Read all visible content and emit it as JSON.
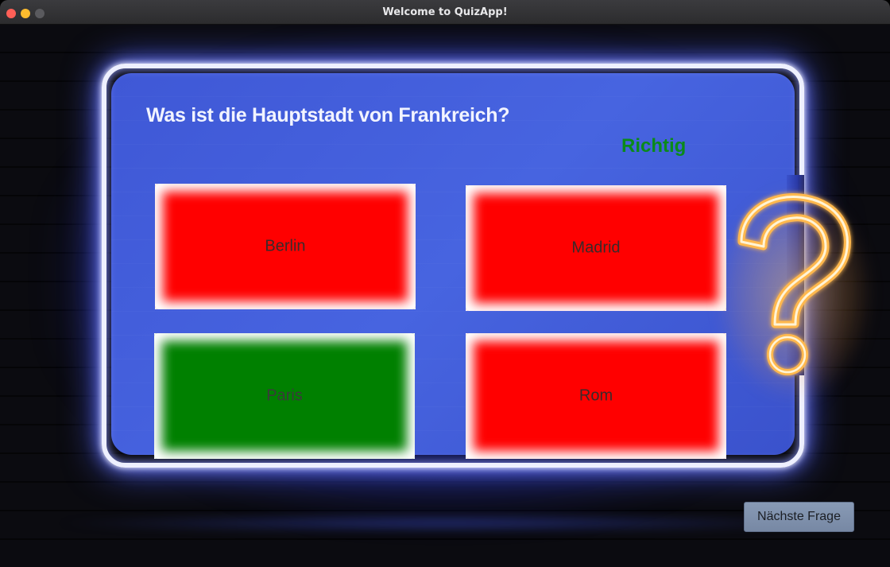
{
  "window": {
    "title": "Welcome to QuizApp!"
  },
  "quiz": {
    "question": "Was ist die Hauptstadt von Frankreich?",
    "feedback": "Richtig",
    "answers": [
      {
        "label": "Berlin",
        "state": "wrong"
      },
      {
        "label": "Madrid",
        "state": "wrong"
      },
      {
        "label": "Paris",
        "state": "correct"
      },
      {
        "label": "Rom",
        "state": "wrong"
      }
    ],
    "next_button_label": "Nächste Frage"
  },
  "colors": {
    "correct": "#008000",
    "wrong": "#ff0000",
    "feedback_text": "#0a8a1a",
    "panel": "#4764e0",
    "neon_frame": "#eef0ff",
    "question_mark_neon": "#ffb84d"
  },
  "icons": {
    "decoration": "question-mark-neon-icon"
  }
}
